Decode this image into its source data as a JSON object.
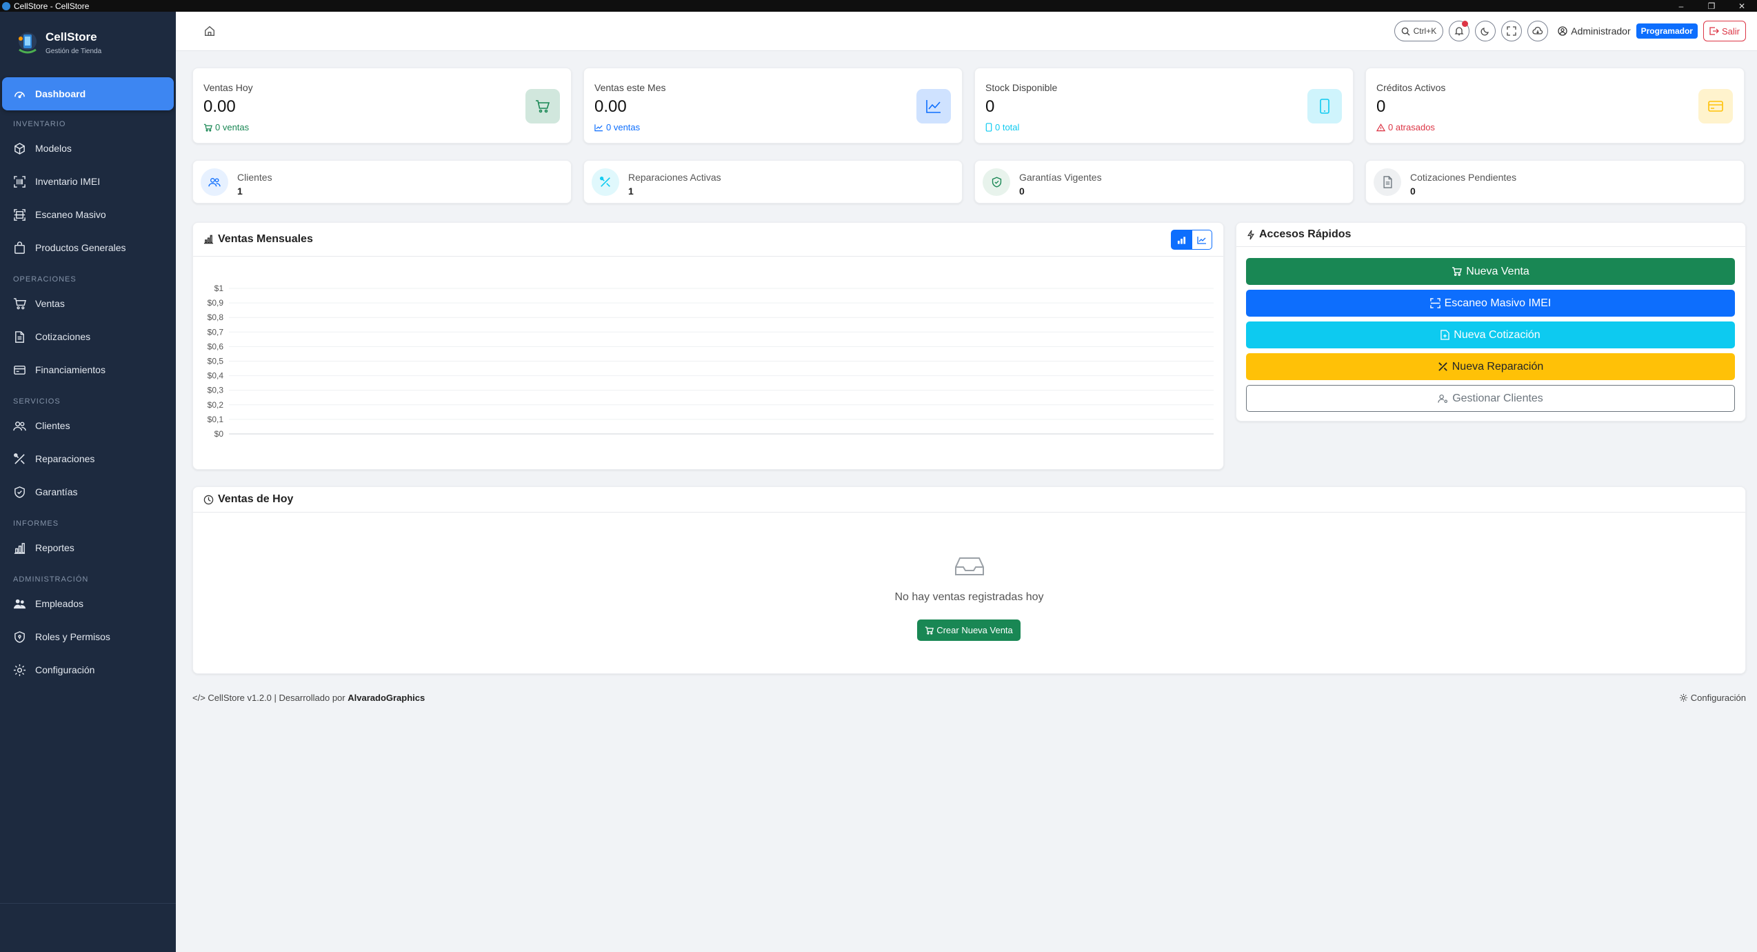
{
  "window": {
    "title": "CellStore - CellStore"
  },
  "brand": {
    "name": "CellStore",
    "subtitle": "Gestión de Tienda"
  },
  "sidebar": {
    "active": {
      "label": "Dashboard",
      "icon": "gauge-icon"
    },
    "sections": [
      {
        "title": "INVENTARIO",
        "items": [
          {
            "label": "Modelos",
            "icon": "box-icon"
          },
          {
            "label": "Inventario IMEI",
            "icon": "barcode-icon"
          },
          {
            "label": "Escaneo Masivo",
            "icon": "scan-icon"
          },
          {
            "label": "Productos Generales",
            "icon": "bag-icon"
          }
        ]
      },
      {
        "title": "OPERACIONES",
        "items": [
          {
            "label": "Ventas",
            "icon": "cart-icon"
          },
          {
            "label": "Cotizaciones",
            "icon": "file-icon"
          },
          {
            "label": "Financiamientos",
            "icon": "credit-card-icon"
          }
        ]
      },
      {
        "title": "SERVICIOS",
        "items": [
          {
            "label": "Clientes",
            "icon": "people-icon"
          },
          {
            "label": "Reparaciones",
            "icon": "tools-icon"
          },
          {
            "label": "Garantías",
            "icon": "shield-icon"
          }
        ]
      },
      {
        "title": "INFORMES",
        "items": [
          {
            "label": "Reportes",
            "icon": "bar-chart-icon"
          }
        ]
      },
      {
        "title": "ADMINISTRACIÓN",
        "items": [
          {
            "label": "Empleados",
            "icon": "people-fill-icon"
          },
          {
            "label": "Roles y Permisos",
            "icon": "shield-lock-icon"
          },
          {
            "label": "Configuración",
            "icon": "gear-icon"
          }
        ]
      }
    ]
  },
  "topbar": {
    "search_shortcut": "Ctrl+K",
    "user_name": "Administrador",
    "role_badge": "Programador",
    "logout": "Salir"
  },
  "stats": [
    {
      "label": "Ventas Hoy",
      "value": "0.00",
      "sub": "0 ventas",
      "color": "#198754",
      "bg": "#d1e7dd"
    },
    {
      "label": "Ventas este Mes",
      "value": "0.00",
      "sub": "0 ventas",
      "color": "#0d6efd",
      "bg": "#cfe2ff"
    },
    {
      "label": "Stock Disponible",
      "value": "0",
      "sub": "0 total",
      "color": "#0dcaf0",
      "bg": "#cff4fc"
    },
    {
      "label": "Créditos Activos",
      "value": "0",
      "sub": "0 atrasados",
      "color": "#dc3545",
      "icon_color": "#ffc107",
      "bg": "#fff3cd"
    }
  ],
  "mini_stats": [
    {
      "label": "Clientes",
      "value": "1"
    },
    {
      "label": "Reparaciones Activas",
      "value": "1"
    },
    {
      "label": "Garantías Vigentes",
      "value": "0"
    },
    {
      "label": "Cotizaciones Pendientes",
      "value": "0"
    }
  ],
  "chart_panel": {
    "title": "Ventas Mensuales"
  },
  "chart_data": {
    "type": "bar",
    "title": "",
    "xlabel": "",
    "ylabel": "",
    "categories": [],
    "series": [],
    "ylim": [
      0,
      1
    ],
    "yticks": [
      "$0",
      "$0,1",
      "$0,2",
      "$0,3",
      "$0,4",
      "$0,5",
      "$0,6",
      "$0,7",
      "$0,8",
      "$0,9",
      "$1"
    ],
    "grid": true
  },
  "quick_access": {
    "title": "Accesos Rápidos",
    "buttons": [
      {
        "label": "Nueva Venta"
      },
      {
        "label": "Escaneo Masivo IMEI"
      },
      {
        "label": "Nueva Cotización"
      },
      {
        "label": "Nueva Reparación"
      },
      {
        "label": "Gestionar Clientes"
      }
    ]
  },
  "today_sales": {
    "title": "Ventas de Hoy",
    "empty_text": "No hay ventas registradas hoy",
    "create_button": "Crear Nueva Venta"
  },
  "footer": {
    "version_text": "CellStore v1.2.0 | Desarrollado por",
    "developer": "AlvaradoGraphics",
    "settings_link": "Configuración"
  }
}
